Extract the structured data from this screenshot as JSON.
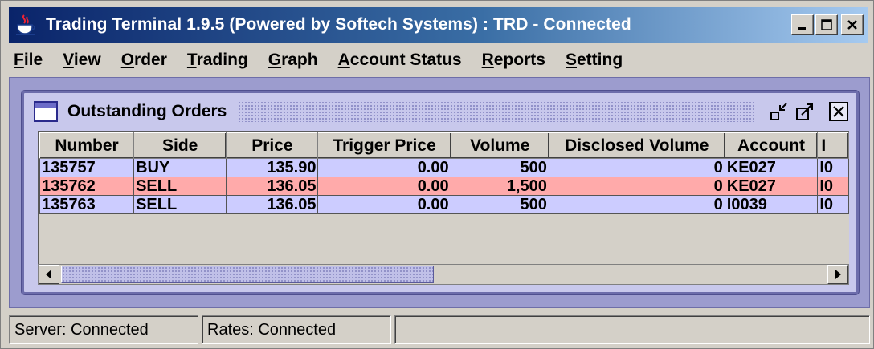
{
  "window": {
    "title": "Trading Terminal 1.9.5 (Powered by Softech Systems)   :   TRD - Connected",
    "icon": "java-coffee-icon",
    "controls": [
      "minimize-icon",
      "maximize-icon",
      "close-icon"
    ]
  },
  "menu": [
    {
      "label": "File",
      "mnemonic": "F"
    },
    {
      "label": "View",
      "mnemonic": "V"
    },
    {
      "label": "Order",
      "mnemonic": "O"
    },
    {
      "label": "Trading",
      "mnemonic": "T"
    },
    {
      "label": "Graph",
      "mnemonic": "G"
    },
    {
      "label": "Account Status",
      "mnemonic": "A"
    },
    {
      "label": "Reports",
      "mnemonic": "R"
    },
    {
      "label": "Setting",
      "mnemonic": "S"
    }
  ],
  "frame": {
    "title": "Outstanding Orders",
    "controls": [
      "minimize-icon",
      "maximize-icon",
      "close-icon"
    ]
  },
  "table": {
    "columns": [
      "Number",
      "Side",
      "Price",
      "Trigger Price",
      "Volume",
      "Disclosed Volume",
      "Account",
      "I"
    ],
    "rows": [
      {
        "number": "135757",
        "side": "BUY",
        "price": "135.90",
        "trigger_price": "0.00",
        "volume": "500",
        "disclosed_volume": "0",
        "account": "KE027",
        "extra": "I0"
      },
      {
        "number": "135762",
        "side": "SELL",
        "price": "136.05",
        "trigger_price": "0.00",
        "volume": "1,500",
        "disclosed_volume": "0",
        "account": "KE027",
        "extra": "I0"
      },
      {
        "number": "135763",
        "side": "SELL",
        "price": "136.05",
        "trigger_price": "0.00",
        "volume": "500",
        "disclosed_volume": "0",
        "account": "I0039",
        "extra": "I0"
      }
    ]
  },
  "colors": {
    "buy_row": "#ccccff",
    "sell_row": "#ffaaaa",
    "title_bar": "#0a246a"
  },
  "status": {
    "server": "Server: Connected",
    "rates": "Rates: Connected",
    "extra": ""
  }
}
